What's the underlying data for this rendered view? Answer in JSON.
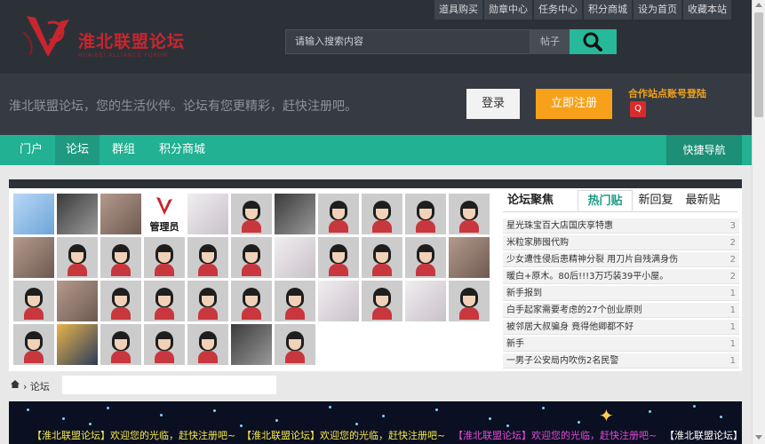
{
  "header": {
    "logo_text": "淮北联盟论坛",
    "logo_sub": "HUAIBEI ALLIANCE FORUM",
    "top_links": [
      "道具购买",
      "勋章中心",
      "任务中心",
      "积分商城",
      "设为首页",
      "收藏本站"
    ]
  },
  "search": {
    "placeholder": "请输入搜索内容",
    "type": "帖子"
  },
  "welcome": {
    "text": "淮北联盟论坛，您的生活伙伴。论坛有您更精彩，赶快注册吧。",
    "login": "登录",
    "register": "立即注册",
    "partner": "合作站点账号登陆"
  },
  "nav": {
    "items": [
      "门户",
      "论坛",
      "群组",
      "积分商城"
    ],
    "quick": "快捷导航"
  },
  "avatars": {
    "admin_label": "管理员"
  },
  "tabs": {
    "title": "论坛聚焦",
    "items": [
      "热门贴",
      "新回复",
      "最新贴"
    ]
  },
  "posts": [
    {
      "title": "星光珠宝百大店国庆享特惠",
      "count": "3"
    },
    {
      "title": "米粒家肺囤代购",
      "count": "2"
    },
    {
      "title": "少女遭性侵后患精神分裂 用刀片自残满身伤",
      "count": "2"
    },
    {
      "title": "暖白+原木。80后!!!3万巧装39平小屋。",
      "count": "2"
    },
    {
      "title": "新手报到",
      "count": "1"
    },
    {
      "title": "白手起家需要考虑的27个创业原则",
      "count": "1"
    },
    {
      "title": "被邻居大叔骗身 竟得他卿都不好",
      "count": "1"
    },
    {
      "title": "新手",
      "count": "1"
    },
    {
      "title": "一男子公安局内吹伤2名民警",
      "count": "1"
    }
  ],
  "breadcrumb": {
    "sep": "›",
    "label": "论坛"
  },
  "banner": {
    "messages": [
      "【淮北联盟论坛】欢迎您的光临，赶快注册吧~",
      "【淮北联盟论坛】欢迎您的光临，赶快注册吧~",
      "【淮北联盟论坛】欢迎您的光临，赶快注册吧~",
      "【淮北联盟论坛】联系"
    ],
    "colors": [
      "#f5e94e",
      "#f5e94e",
      "#e24bd8",
      "#ffffff"
    ]
  }
}
